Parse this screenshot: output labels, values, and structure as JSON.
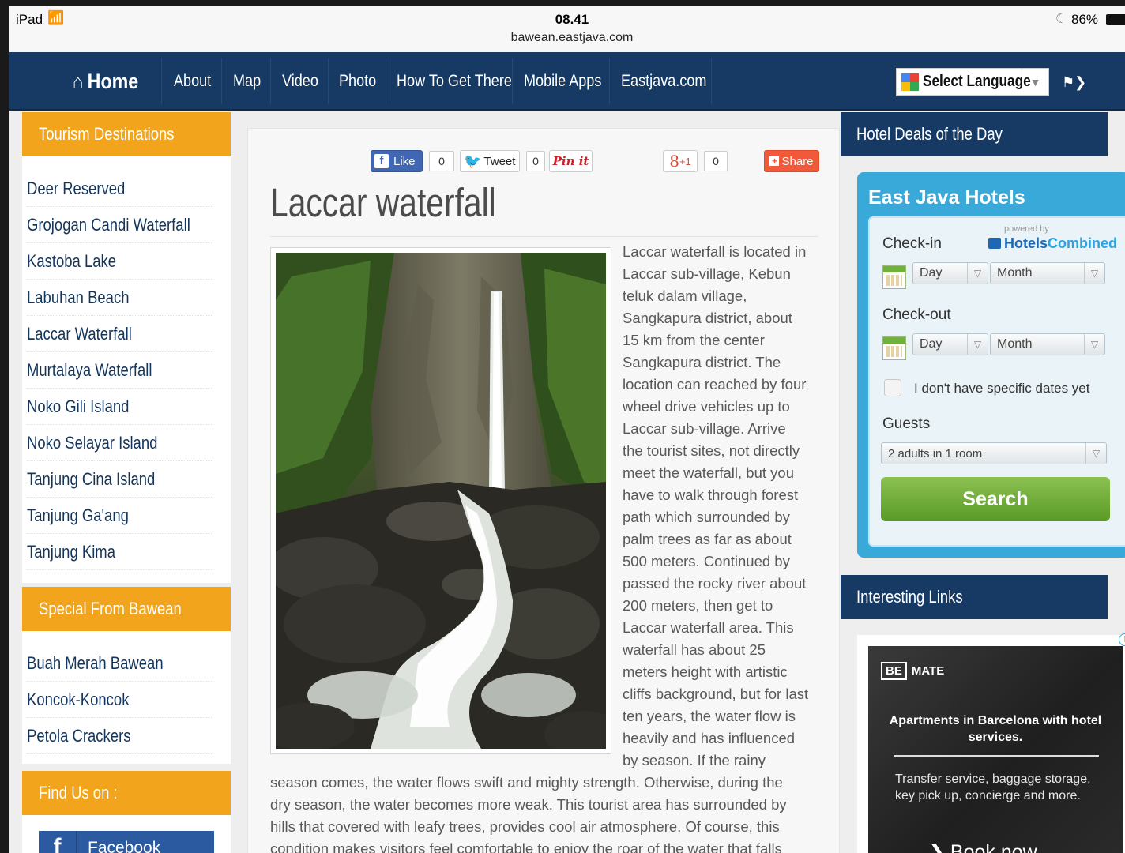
{
  "status_bar": {
    "device": "iPad",
    "time": "08.41",
    "url": "bawean.eastjava.com",
    "battery": "86%"
  },
  "nav": {
    "items": [
      "Home",
      "About",
      "Map",
      "Video",
      "Photo",
      "How To Get There",
      "Mobile Apps",
      "Eastjava.com"
    ],
    "language_label": "Select Language"
  },
  "left_sidebar": {
    "tourism_title": "Tourism Destinations",
    "tourism_links": [
      "Deer Reserved",
      "Grojogan Candi Waterfall",
      "Kastoba Lake",
      "Labuhan Beach",
      "Laccar Waterfall",
      "Murtalaya Waterfall",
      "Noko Gili Island",
      "Noko Selayar Island",
      "Tanjung Cina Island",
      "Tanjung Ga'ang",
      "Tanjung Kima"
    ],
    "special_title": "Special From Bawean",
    "special_links": [
      "Buah Merah Bawean",
      "Koncok-Koncok",
      "Petola Crackers"
    ],
    "find_title": "Find Us on :",
    "facebook_label": "Facebook"
  },
  "social": {
    "like": "Like",
    "like_count": "0",
    "tweet": "Tweet",
    "tweet_count": "0",
    "pin": "Pin it",
    "gplus": "+1",
    "gplus_count": "0",
    "share": "Share"
  },
  "article": {
    "title": "Laccar waterfall",
    "side_lines": [
      "Laccar waterfall is located in",
      "Laccar sub-village, Kebun",
      "teluk dalam village,",
      "Sangkapura district, about",
      "15 km from the center",
      "Sangkapura district. The",
      "location can reached by four",
      "wheel drive vehicles up to",
      "Laccar sub-village. Arrive",
      "the tourist sites, not directly",
      "meet the waterfall, but you",
      "have to walk through forest",
      "path which surrounded by",
      "palm trees as far as about",
      "500 meters. Continued by",
      "passed the rocky river about",
      "200 meters, then get to",
      "Laccar waterfall area. This",
      "waterfall has about 25",
      "meters height with artistic",
      "cliffs background, but for last",
      "ten years, the water flow is",
      "heavily and has influenced",
      "by season. If the rainy"
    ],
    "bottom_lines": [
      "season comes, the water flows swift and mighty strength. Otherwise, during the",
      "dry season, the water becomes more weak. This tourist area has surrounded by",
      "hills that covered with leafy trees, provides cool air atmosphere. Of course, this",
      "condition makes visitors feel comfortable to enjoy the roar of the water that falls"
    ]
  },
  "right_sidebar": {
    "hotel_deals_title": "Hotel Deals of the Day",
    "widget": {
      "title": "East Java Hotels",
      "powered_by": "powered by",
      "brand_a": "Hotels",
      "brand_b": "Combined",
      "checkin": "Check-in",
      "checkout": "Check-out",
      "day": "Day",
      "month": "Month",
      "no_dates": "I don't have specific dates yet",
      "guests": "Guests",
      "guests_value": "2 adults in 1 room",
      "search": "Search"
    },
    "links_title": "Interesting Links",
    "ad": {
      "logo_a": "BE",
      "logo_b": "MATE",
      "headline": "Apartments in Barcelona with hotel services.",
      "body": "Transfer service, baggage storage, key pick up, concierge and more.",
      "cta": "Book now"
    }
  }
}
